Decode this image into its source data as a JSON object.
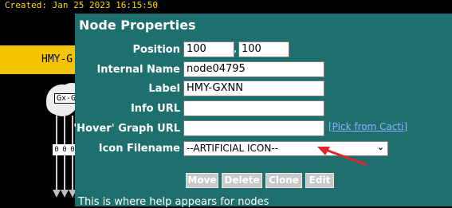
{
  "background": {
    "created_text": "Created: Jan 25 2023 16:15:50",
    "node_label": "HMY-G",
    "gx_label": "Gx-G",
    "tick_labels": [
      "0",
      "0",
      "0"
    ]
  },
  "dialog": {
    "title": "Node Properties",
    "fields": {
      "position_label": "Position",
      "position_x": "100",
      "position_y": "100",
      "internal_name_label": "Internal Name",
      "internal_name": "node04795",
      "label_label": "Label",
      "label_value": "HMY-GXNN",
      "info_url_label": "Info URL",
      "info_url": "",
      "hover_graph_url_label": "'Hover' Graph URL",
      "hover_graph_url": "",
      "pick_link": "[Pick from Cacti]",
      "icon_filename_label": "Icon Filename",
      "icon_filename": "--ARTIFICIAL ICON--"
    },
    "buttons": {
      "move": "Move",
      "delete": "Delete",
      "clone": "Clone",
      "edit": "Edit"
    },
    "help_text": "This is where help appears for nodes"
  },
  "colors": {
    "dialog_bg": "#1e706e",
    "node_bar": "#f5c400",
    "annotation_arrow": "#e0262b"
  },
  "icons": {
    "select_chevron": "chevron-down-icon",
    "annotation": "red-arrow-icon"
  }
}
